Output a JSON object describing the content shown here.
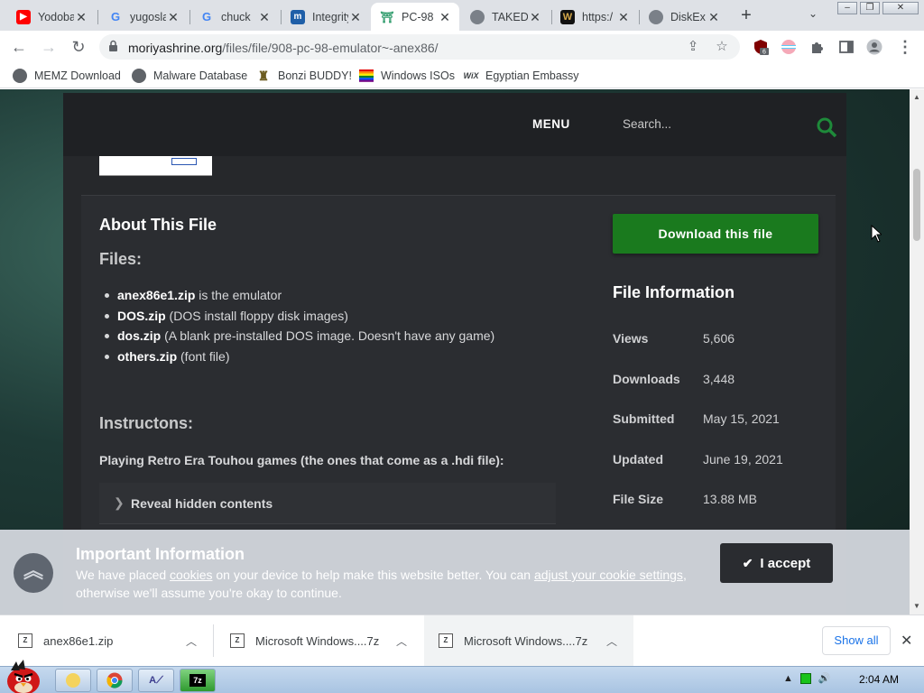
{
  "tabs": [
    {
      "title": "Yodobashi",
      "favicon": "youtube-icon"
    },
    {
      "title": "yugoslav",
      "favicon": "google-icon"
    },
    {
      "title": "chuck",
      "favicon": "google-icon"
    },
    {
      "title": "Integrity",
      "favicon": "integrity-icon"
    },
    {
      "title": "PC-98",
      "favicon": "site-icon",
      "active": true
    },
    {
      "title": "TAKED",
      "favicon": "globe-icon"
    },
    {
      "title": "https:/",
      "favicon": "w-icon"
    },
    {
      "title": "DiskEx",
      "favicon": "globe-icon"
    }
  ],
  "url": {
    "domain": "moriyashrine.org",
    "path": "/files/file/908-pc-98-emulator~-anex86/"
  },
  "extensions": {
    "ublock_badge": "6"
  },
  "bookmarks": [
    {
      "label": "MEMZ Download",
      "icon": "globe-icon"
    },
    {
      "label": "Malware Database",
      "icon": "globe-icon"
    },
    {
      "label": "Bonzi BUDDY!",
      "icon": "bonzi-icon"
    },
    {
      "label": "Windows ISOs",
      "icon": "windows-flag-icon"
    },
    {
      "label": "Egyptian Embassy",
      "icon": "wix-icon",
      "icon_text": "WiX"
    }
  ],
  "site": {
    "menu_label": "MENU",
    "search_placeholder": "Search..."
  },
  "about": {
    "title": "About This File",
    "files_heading": "Files:",
    "files": [
      {
        "name": "anex86e1.zip",
        "desc": " is the emulator"
      },
      {
        "name": "DOS.zip",
        "desc": " (DOS install floppy disk images)"
      },
      {
        "name": "dos.zip",
        "desc": " (A blank pre-installed DOS image. Doesn't have any game)"
      },
      {
        "name": "others.zip",
        "desc": " (font file)"
      }
    ],
    "instructions_heading": "Instructons:",
    "playing_text": "Playing Retro Era Touhou games (the ones that come as a .hdi file):",
    "spoiler_label": "Reveal hidden contents"
  },
  "sidebar": {
    "download_label": "Download this file",
    "info_title": "File Information",
    "info": [
      {
        "key": "Views",
        "value": "5,606"
      },
      {
        "key": "Downloads",
        "value": "3,448"
      },
      {
        "key": "Submitted",
        "value": "May 15, 2021"
      },
      {
        "key": "Updated",
        "value": "June 19, 2021"
      },
      {
        "key": "File Size",
        "value": "13.88 MB"
      }
    ]
  },
  "cookie": {
    "title": "Important Information",
    "text_1": "We have placed ",
    "link_1": "cookies",
    "text_2": " on your device to help make this website better. You can ",
    "link_2": "adjust your cookie settings",
    "text_3": ",",
    "text_4": "otherwise we'll assume you're okay to continue.",
    "accept_label": "I accept"
  },
  "downloads": [
    {
      "name": "anex86e1.zip"
    },
    {
      "name": "Microsoft Windows....7z"
    },
    {
      "name": "Microsoft Windows....7z"
    }
  ],
  "downloads_show_all": "Show all",
  "taskbar": {
    "clock": "2:04 AM"
  }
}
